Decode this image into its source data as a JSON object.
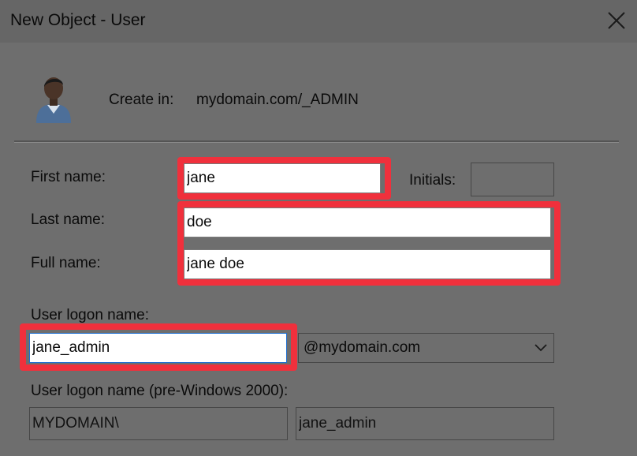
{
  "window": {
    "title": "New Object - User",
    "close_glyph": "close-icon"
  },
  "header": {
    "icon": "user-icon",
    "create_in_label": "Create in:",
    "create_in_value": "mydomain.com/_ADMIN"
  },
  "form": {
    "first_name": {
      "label": "First name:",
      "value": "jane"
    },
    "initials": {
      "label": "Initials:",
      "value": ""
    },
    "last_name": {
      "label": "Last name:",
      "value": "doe"
    },
    "full_name": {
      "label": "Full name:",
      "value": "jane doe"
    },
    "logon_name": {
      "label": "User logon name:",
      "value": "jane_admin"
    },
    "domain_suffix": {
      "selected": "@mydomain.com"
    },
    "pre2000": {
      "label": "User logon name (pre-Windows 2000):",
      "domain": "MYDOMAIN\\",
      "name": "jane_admin"
    }
  },
  "colors": {
    "highlight": "#f0303c",
    "background": "#6e6e6e"
  }
}
